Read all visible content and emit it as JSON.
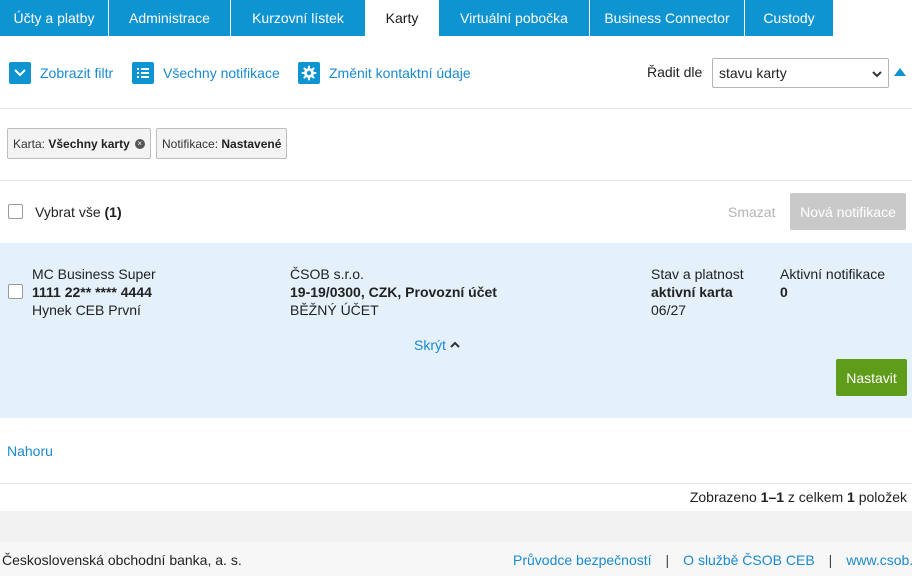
{
  "nav": {
    "tabs": [
      {
        "label": "Účty a platby",
        "active": false
      },
      {
        "label": "Administrace",
        "active": false
      },
      {
        "label": "Kurzovní lístek",
        "active": false
      },
      {
        "label": "Karty",
        "active": true
      },
      {
        "label": "Virtuální pobočka",
        "active": false
      },
      {
        "label": "Business Connector",
        "active": false
      },
      {
        "label": "Custody",
        "active": false
      }
    ]
  },
  "toolbar": {
    "filter_label": "Zobrazit filtr",
    "all_notifications_label": "Všechny notifikace",
    "change_contact_label": "Změnit kontaktní údaje",
    "sort_label": "Řadit dle",
    "sort_value": "stavu karty"
  },
  "filters": {
    "card_prefix": "Karta:",
    "card_value": "Všechny karty",
    "notification_prefix": "Notifikace:",
    "notification_value": "Nastavené"
  },
  "list_header": {
    "select_all_label": "Vybrat vše",
    "select_all_count": "(1)",
    "delete_label": "Smazat",
    "new_notification_label": "Nová notifikace"
  },
  "card_row": {
    "card_type": "MC Business Super",
    "card_number_start": "1111 22** **** ",
    "card_number_end": "4444",
    "holder": "Hynek CEB První",
    "company": "ČSOB s.r.o.",
    "account": "19-19/0300, CZK, Provozní účet",
    "account_type": "BĚŽNÝ ÚČET",
    "state_header": "Stav a platnost",
    "state_value": "aktivní karta",
    "validity": "06/27",
    "notif_header": "Aktivní notifikace",
    "notif_value": "0",
    "hide_label": "Skrýt",
    "set_label": "Nastavit"
  },
  "bottom": {
    "top_link": "Nahoru",
    "pager_prefix": "Zobrazeno ",
    "pager_range": "1–1",
    "pager_mid": " z celkem ",
    "pager_total": "1",
    "pager_suffix": " položek"
  },
  "footer": {
    "bank_name": "Československá obchodní banka, a. s.",
    "links": [
      "Průvodce bezpečností",
      "O službě ČSOB CEB",
      "www.csob.cz"
    ]
  },
  "colors": {
    "brand_blue": "#0f94d2",
    "link_blue": "#1a8ad0",
    "action_green": "#5e9c1a",
    "row_bg": "#e4f1fa"
  }
}
